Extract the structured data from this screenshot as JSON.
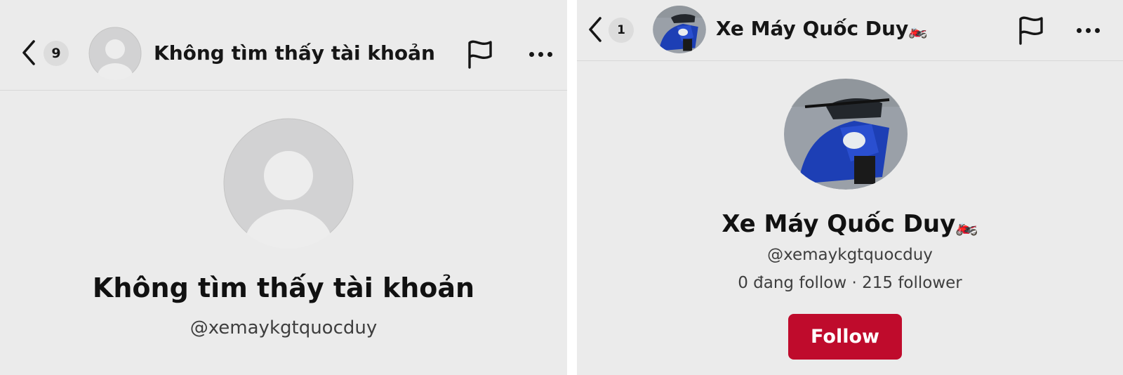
{
  "left_profile": {
    "header": {
      "notification_count": "9",
      "title": "Không tìm thấy tài khoản",
      "back_icon": "chevron-left-icon",
      "report_icon": "flag-icon",
      "more_icon": "more-horizontal-icon"
    },
    "profile": {
      "avatar": "default-user-avatar",
      "name": "Không tìm thấy tài khoản",
      "username": "@xemaykgtquocduy"
    }
  },
  "right_profile": {
    "header": {
      "notification_count": "1",
      "title": "Xe Máy Quốc Duy",
      "title_emoji": "🏍️",
      "back_icon": "chevron-left-icon",
      "report_icon": "flag-icon",
      "more_icon": "more-horizontal-icon"
    },
    "profile": {
      "avatar": "blue-motorcycle-photo",
      "name": "Xe Máy Quốc Duy",
      "name_emoji": "🏍️",
      "username": "@xemaykgtquocduy",
      "stats": "0 đang follow · 215 follower",
      "follow_label": "Follow"
    }
  },
  "colors": {
    "panel_background": "#ebebeb",
    "text": "#161616",
    "follow_button": "#bf0b2c"
  }
}
